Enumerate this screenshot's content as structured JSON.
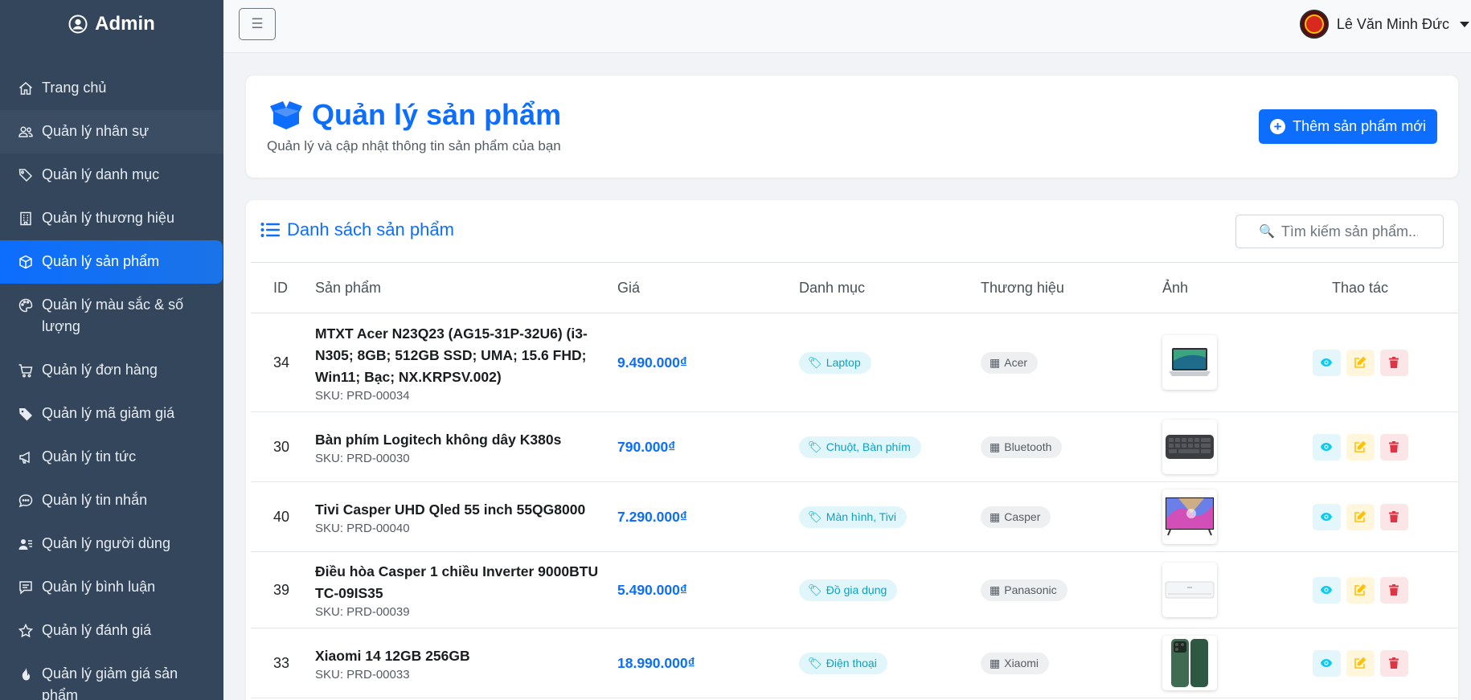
{
  "brand": {
    "label": "Admin",
    "icon": "user-circle-icon"
  },
  "sidebar": {
    "items": [
      {
        "label": "Trang chủ",
        "icon": "home-icon"
      },
      {
        "label": "Quản lý nhân sự",
        "icon": "users-icon"
      },
      {
        "label": "Quản lý danh mục",
        "icon": "tags-icon"
      },
      {
        "label": "Quản lý thương hiệu",
        "icon": "building-icon"
      },
      {
        "label": "Quản lý sản phẩm",
        "icon": "box-icon"
      },
      {
        "label": "Quản lý màu sắc & số lượng",
        "icon": "palette-icon"
      },
      {
        "label": "Quản lý đơn hàng",
        "icon": "cart-icon"
      },
      {
        "label": "Quản lý mã giảm giá",
        "icon": "tag-icon"
      },
      {
        "label": "Quản lý tin tức",
        "icon": "megaphone-icon"
      },
      {
        "label": "Quản lý tin nhắn",
        "icon": "chat-icon"
      },
      {
        "label": "Quản lý người dùng",
        "icon": "user-list-icon"
      },
      {
        "label": "Quản lý bình luận",
        "icon": "comment-icon"
      },
      {
        "label": "Quản lý đánh giá",
        "icon": "star-icon"
      },
      {
        "label": "Quản lý giảm giá sản phẩm",
        "icon": "fire-icon"
      }
    ],
    "active_index": 4
  },
  "topbar": {
    "toggle_icon": "menu-icon",
    "user_name": "Lê Văn Minh Đức"
  },
  "header": {
    "title": "Quản lý sản phẩm",
    "subtitle": "Quản lý và cập nhật thông tin sản phẩm của bạn",
    "add_button": "Thêm sản phẩm mới"
  },
  "list": {
    "title": "Danh sách sản phẩm",
    "search_placeholder": "Tìm kiếm sản phẩm...",
    "columns": [
      "ID",
      "Sản phẩm",
      "Giá",
      "Danh mục",
      "Thương hiệu",
      "Ảnh",
      "Thao tác"
    ],
    "rows": [
      {
        "id": "34",
        "name": "MTXT Acer N23Q23 (AG15-31P-32U6) (i3-N305; 8GB; 512GB SSD; UMA; 15.6 FHD; Win11; Bạc; NX.KRPSV.002)",
        "sku": "SKU: PRD-00034",
        "price": "9.490.000₫",
        "category": "Laptop",
        "brand": "Acer",
        "image": "laptop"
      },
      {
        "id": "30",
        "name": "Bàn phím Logitech không dây K380s",
        "sku": "SKU: PRD-00030",
        "price": "790.000₫",
        "category": "Chuột, Bàn phím",
        "brand": "Bluetooth",
        "image": "keyboard"
      },
      {
        "id": "40",
        "name": "Tivi Casper UHD Qled 55 inch 55QG8000",
        "sku": "SKU: PRD-00040",
        "price": "7.290.000₫",
        "category": "Màn hình, Tivi",
        "brand": "Casper",
        "image": "tv"
      },
      {
        "id": "39",
        "name": "Điều hòa Casper 1 chiều Inverter 9000BTU TC-09IS35",
        "sku": "SKU: PRD-00039",
        "price": "5.490.000₫",
        "category": "Đồ gia dụng",
        "brand": "Panasonic",
        "image": "aircon"
      },
      {
        "id": "33",
        "name": "Xiaomi 14 12GB 256GB",
        "sku": "SKU: PRD-00033",
        "price": "18.990.000₫",
        "category": "Điện thoại",
        "brand": "Xiaomi",
        "image": "phone"
      }
    ]
  },
  "colors": {
    "primary": "#0d6efd",
    "sidebar_bg": "#34465b",
    "info": "#0dcaf0",
    "warning": "#ffc107",
    "danger": "#dc3545"
  }
}
